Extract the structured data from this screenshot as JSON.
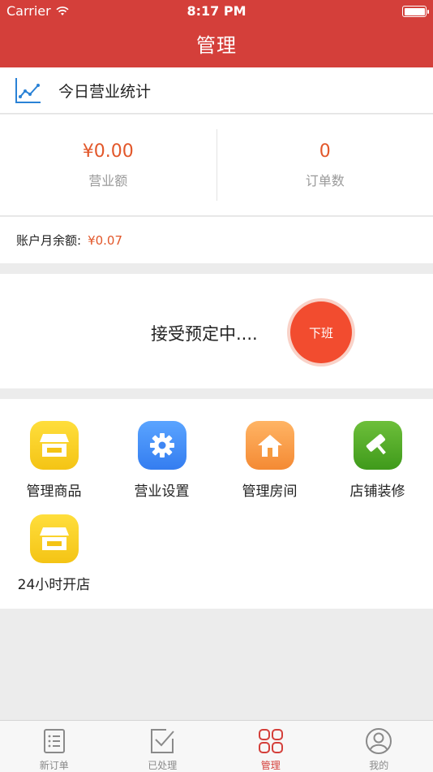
{
  "status_bar": {
    "carrier": "Carrier",
    "time": "8:17 PM"
  },
  "nav": {
    "title": "管理"
  },
  "stats": {
    "header": "今日营业统计",
    "revenue_value": "¥0.00",
    "revenue_label": "营业额",
    "orders_value": "0",
    "orders_label": "订单数"
  },
  "balance": {
    "label": "账户月余额:",
    "amount": "¥0.07"
  },
  "work_status": {
    "text": "接受预定中....",
    "button": "下班"
  },
  "menu": {
    "items": [
      {
        "label": "管理商品",
        "icon": "shop-icon"
      },
      {
        "label": "营业设置",
        "icon": "gear-icon"
      },
      {
        "label": "管理房间",
        "icon": "house-icon"
      },
      {
        "label": "店铺装修",
        "icon": "paint-roller-icon"
      },
      {
        "label": "24小时开店",
        "icon": "shop-icon"
      }
    ]
  },
  "tabs": [
    {
      "label": "新订单",
      "icon": "list-icon"
    },
    {
      "label": "已处理",
      "icon": "processed-icon"
    },
    {
      "label": "管理",
      "icon": "grid-icon",
      "active": true
    },
    {
      "label": "我的",
      "icon": "user-icon"
    }
  ],
  "colors": {
    "brand": "#d43f3a",
    "accent": "#e2572a"
  }
}
